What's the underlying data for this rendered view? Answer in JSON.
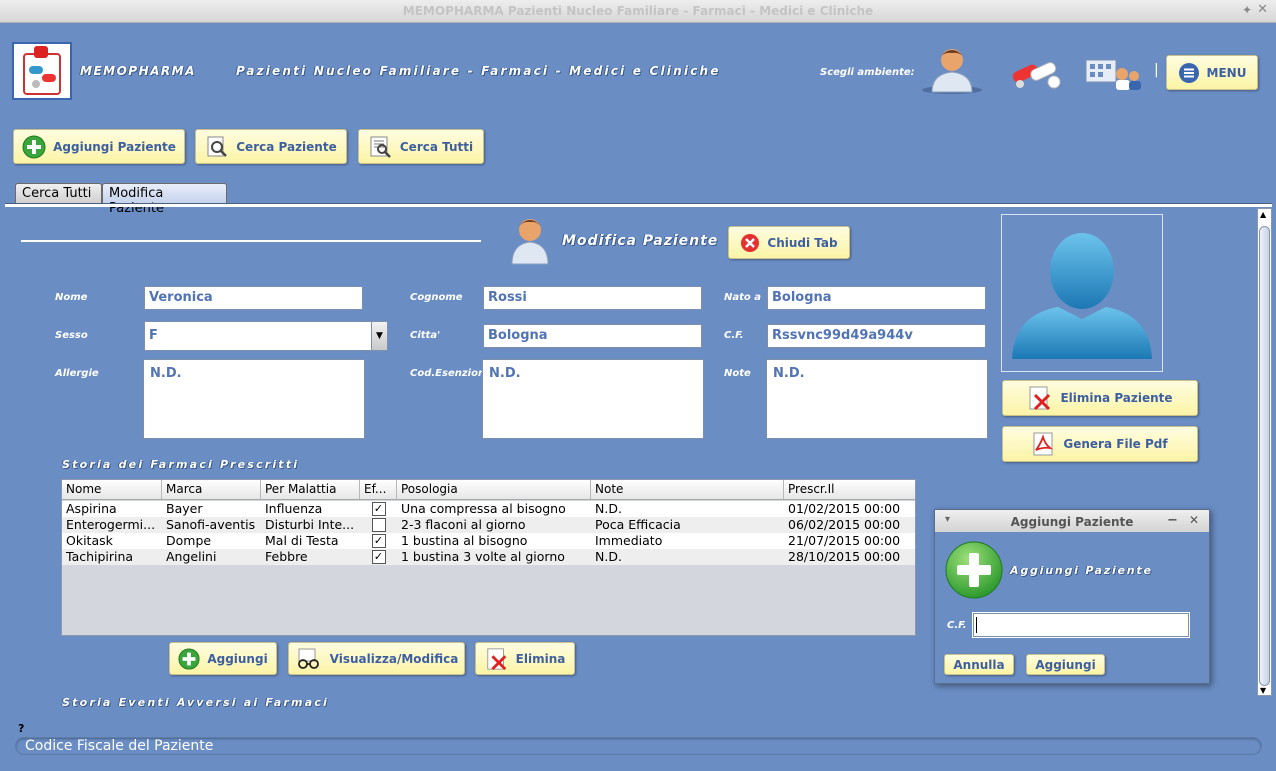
{
  "window": {
    "title": "MEMOPHARMA   Pazienti Nucleo Familiare - Farmaci - Medici e Cliniche"
  },
  "header": {
    "brand": "MEMOPHARMA",
    "subtitle": "Pazienti Nucleo Familiare - Farmaci - Medici e Cliniche",
    "env_label": "Scegli ambiente:",
    "separator": "|",
    "menu_label": "MENU"
  },
  "toolbar": {
    "add_patient": "Aggiungi Paziente",
    "search_patient": "Cerca Paziente",
    "search_all": "Cerca Tutti"
  },
  "tabs": [
    {
      "label": "Cerca Tutti"
    },
    {
      "label": "Modifica Paziente"
    }
  ],
  "form": {
    "title": "Modifica Paziente",
    "close_tab": "Chiudi Tab",
    "labels": {
      "nome": "Nome",
      "cognome": "Cognome",
      "nato_a": "Nato a",
      "sesso": "Sesso",
      "citta": "Citta'",
      "cf": "C.F.",
      "allergie": "Allergie",
      "cod_esenzioni": "Cod.Esenzioni",
      "note": "Note"
    },
    "values": {
      "nome": "Veronica",
      "cognome": "Rossi",
      "nato_a": "Bologna",
      "sesso": "F",
      "citta": "Bologna",
      "cf": "Rssvnc99d49a944v",
      "allergie": "N.D.",
      "cod_esenzioni": "N.D.",
      "note": "N.D."
    }
  },
  "side": {
    "delete_patient": "Elimina Paziente",
    "gen_pdf": "Genera File Pdf"
  },
  "drugs": {
    "title": "Storia dei Farmaci Prescritti",
    "columns": [
      "Nome",
      "Marca",
      "Per Malattia",
      "Ef...",
      "Posologia",
      "Note",
      "Prescr.Il"
    ],
    "rows": [
      {
        "nome": "Aspirina",
        "marca": "Bayer",
        "malattia": "Influenza",
        "eff": "✓",
        "posologia": "Una compressa al bisogno",
        "note": "N.D.",
        "data": "01/02/2015 00:00"
      },
      {
        "nome": "Enterogermi...",
        "marca": "Sanofi-aventis",
        "malattia": "Disturbi Inte...",
        "eff": "",
        "posologia": "2-3 flaconi al giorno",
        "note": "Poca Efficacia",
        "data": "06/02/2015 00:00"
      },
      {
        "nome": "Okitask",
        "marca": "Dompe",
        "malattia": "Mal di Testa",
        "eff": "✓",
        "posologia": "1 bustina al bisogno",
        "note": "Immediato",
        "data": "21/07/2015 00:00"
      },
      {
        "nome": "Tachipirina",
        "marca": "Angelini",
        "malattia": "Febbre",
        "eff": "✓",
        "posologia": "1 bustina 3 volte al giorno",
        "note": "N.D.",
        "data": "28/10/2015 00:00"
      }
    ],
    "add": "Aggiungi",
    "view_edit": "Visualizza/Modifica",
    "delete": "Elimina"
  },
  "events": {
    "title": "Storia Eventi Avversi ai Farmaci"
  },
  "help_mark": "?",
  "status": {
    "text": "Codice Fiscale del Paziente"
  },
  "dialog": {
    "title": "Aggiungi Paziente",
    "heading": "Aggiungi Paziente",
    "cf_label": "C.F.",
    "cf_value": "",
    "cancel": "Annulla",
    "add": "Aggiungi",
    "min_glyph": "−",
    "close_glyph": "✕",
    "menu_glyph": "▾"
  },
  "colors": {
    "background": "#6a8dc4",
    "button": "#fbf4a6",
    "accent_text": "#3d5fa0",
    "field_text": "#5273b4"
  }
}
